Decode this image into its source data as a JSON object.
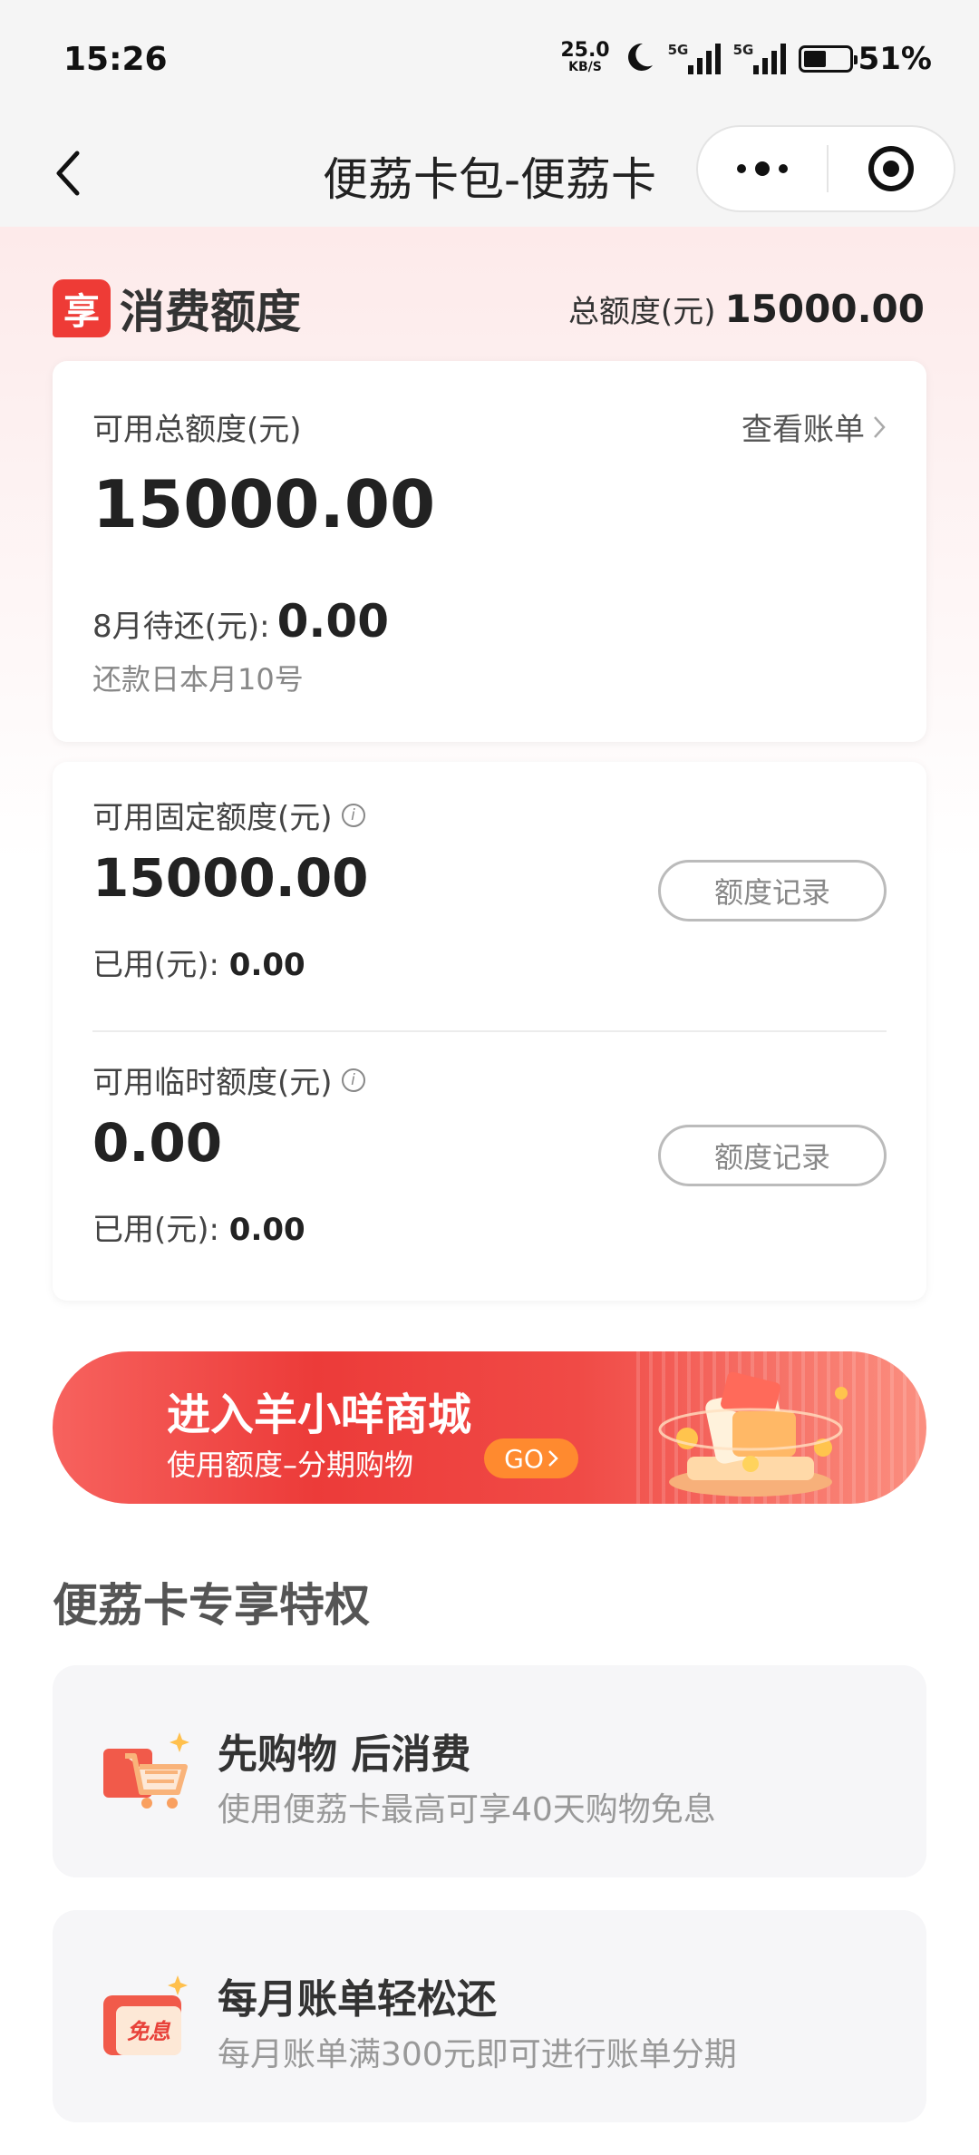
{
  "status_bar": {
    "time": "15:26",
    "net_speed": "25.0",
    "net_speed_unit": "KB/S",
    "sim1_label": "5G",
    "sim2_label": "5G",
    "battery_percent": "51%",
    "battery_level": 0.51
  },
  "nav": {
    "title": "便荔卡包-便荔卡"
  },
  "quota_section": {
    "title": "消费额度",
    "badge_char": "享",
    "total_label": "总额度(元)",
    "total_value": "15000.00"
  },
  "summary_card": {
    "available_label": "可用总额度(元)",
    "bill_link": "查看账单",
    "available_value": "15000.00",
    "due_label": "8月待还(元):",
    "due_value": "0.00",
    "repay_date": "还款日本月10号"
  },
  "fixed_quota": {
    "label": "可用固定额度(元)",
    "value": "15000.00",
    "used_label": "已用(元):",
    "used_value": "0.00",
    "record_button": "额度记录"
  },
  "temp_quota": {
    "label": "可用临时额度(元)",
    "value": "0.00",
    "used_label": "已用(元):",
    "used_value": "0.00",
    "record_button": "额度记录"
  },
  "banner": {
    "title": "进入羊小咩商城",
    "subtitle": "使用额度–分期购物",
    "go_label": "GO"
  },
  "privileges": {
    "title": "便荔卡专享特权",
    "items": [
      {
        "name": "先购物 后消费",
        "desc": "使用便荔卡最高可享40天购物免息",
        "icon": "shopping-cart-icon"
      },
      {
        "name": "每月账单轻松还",
        "desc": "每月账单满300元即可进行账单分期",
        "icon": "interest-free-icon",
        "icon_text": "免息"
      }
    ]
  },
  "colors": {
    "accent_red": "#ee3b36",
    "go_orange": "#ff8a2f"
  }
}
